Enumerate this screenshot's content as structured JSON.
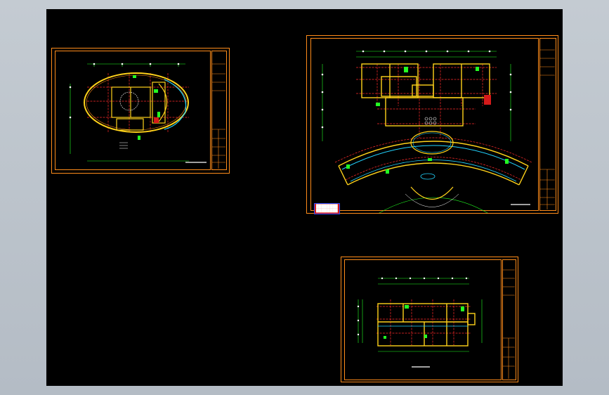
{
  "app": {
    "background": "#000000",
    "frame_color": "#ff8c1a"
  },
  "palette": {
    "wall": "#ffd21a",
    "axis": "#ff2a2a",
    "dimension": "#22ff22",
    "glazing": "#22d4ff",
    "text": "#ffffff",
    "stamp_fill": "#d61a1a",
    "stamp_border": "#2a4dff"
  },
  "drawings": [
    {
      "id": "oval-plan",
      "kind": "elliptical floor plan"
    },
    {
      "id": "curved-plan",
      "kind": "fan-shaped main floor plan"
    },
    {
      "id": "rect-plan",
      "kind": "rectangular floor plan"
    }
  ],
  "stamp": {
    "line1": "████████",
    "line2": "████████"
  },
  "notes_block": ""
}
